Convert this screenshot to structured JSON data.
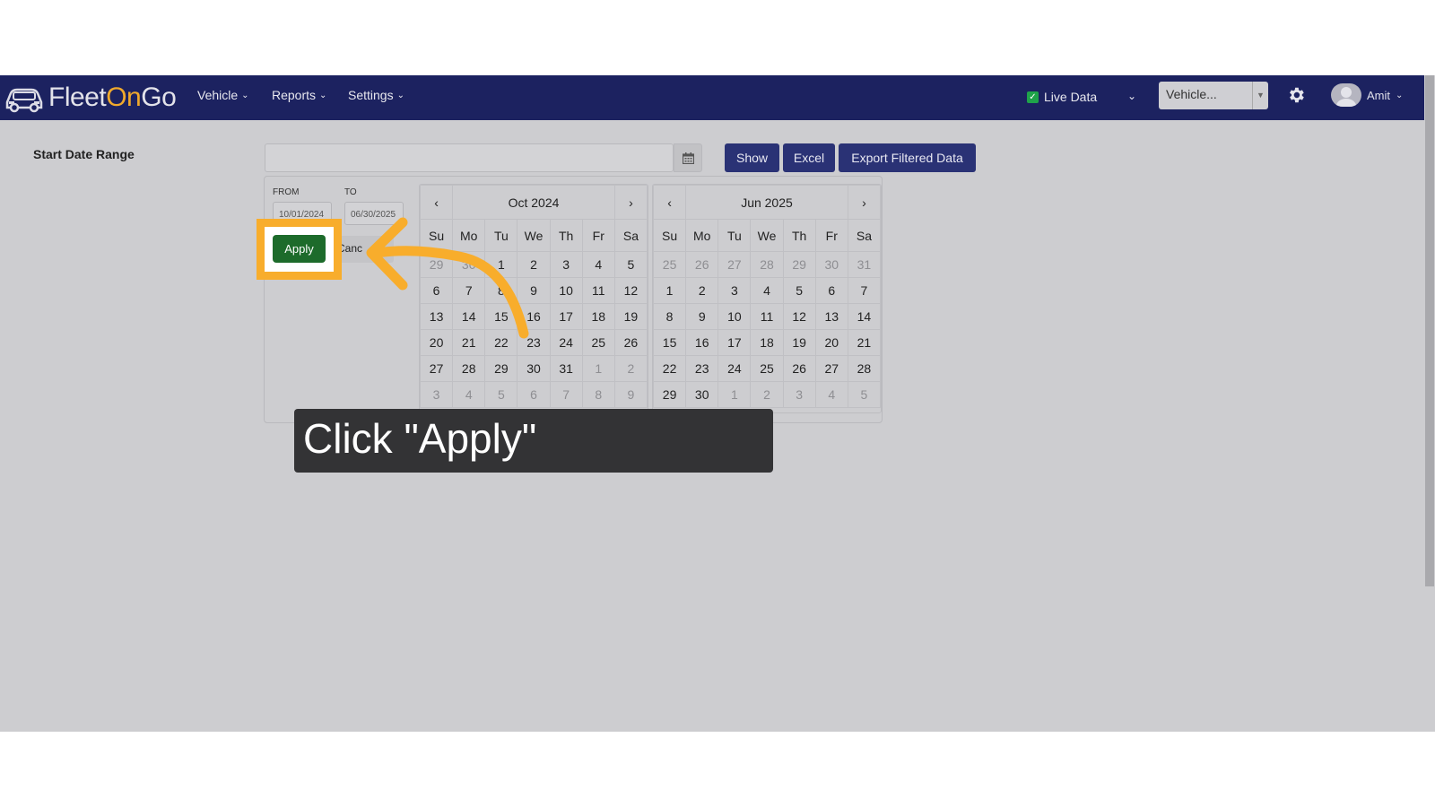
{
  "app": {
    "logo_prefix": "Fleet",
    "logo_accent": "On",
    "logo_suffix": "Go"
  },
  "nav": {
    "menu": [
      {
        "label": "Vehicle"
      },
      {
        "label": "Reports"
      },
      {
        "label": "Settings"
      }
    ],
    "live_data_label": "Live Data",
    "vehicle_select": "Vehicle...",
    "user_name": "Amit"
  },
  "filter": {
    "label": "Start Date Range",
    "show_label": "Show",
    "excel_label": "Excel",
    "export_label": "Export Filtered Data"
  },
  "picker": {
    "from_label": "FROM",
    "to_label": "TO",
    "from_value": "10/01/2024",
    "to_value": "06/30/2025",
    "apply_label": "Apply",
    "cancel_label": "Canc",
    "weekdays": [
      "Su",
      "Mo",
      "Tu",
      "We",
      "Th",
      "Fr",
      "Sa"
    ],
    "left_month": "Oct 2024",
    "right_month": "Jun 2025",
    "left_days": [
      [
        {
          "d": "29",
          "off": true
        },
        {
          "d": "30",
          "off": true
        },
        {
          "d": "1",
          "off": false
        },
        {
          "d": "2",
          "off": false
        },
        {
          "d": "3",
          "off": false
        },
        {
          "d": "4",
          "off": false
        },
        {
          "d": "5",
          "off": false
        }
      ],
      [
        {
          "d": "6",
          "off": false
        },
        {
          "d": "7",
          "off": false
        },
        {
          "d": "8",
          "off": false
        },
        {
          "d": "9",
          "off": false
        },
        {
          "d": "10",
          "off": false
        },
        {
          "d": "11",
          "off": false
        },
        {
          "d": "12",
          "off": false
        }
      ],
      [
        {
          "d": "13",
          "off": false
        },
        {
          "d": "14",
          "off": false
        },
        {
          "d": "15",
          "off": false
        },
        {
          "d": "16",
          "off": false
        },
        {
          "d": "17",
          "off": false
        },
        {
          "d": "18",
          "off": false
        },
        {
          "d": "19",
          "off": false
        }
      ],
      [
        {
          "d": "20",
          "off": false
        },
        {
          "d": "21",
          "off": false
        },
        {
          "d": "22",
          "off": false
        },
        {
          "d": "23",
          "off": false
        },
        {
          "d": "24",
          "off": false
        },
        {
          "d": "25",
          "off": false
        },
        {
          "d": "26",
          "off": false
        }
      ],
      [
        {
          "d": "27",
          "off": false
        },
        {
          "d": "28",
          "off": false
        },
        {
          "d": "29",
          "off": false
        },
        {
          "d": "30",
          "off": false
        },
        {
          "d": "31",
          "off": false
        },
        {
          "d": "1",
          "off": true
        },
        {
          "d": "2",
          "off": true
        }
      ],
      [
        {
          "d": "3",
          "off": true
        },
        {
          "d": "4",
          "off": true
        },
        {
          "d": "5",
          "off": true
        },
        {
          "d": "6",
          "off": true
        },
        {
          "d": "7",
          "off": true
        },
        {
          "d": "8",
          "off": true
        },
        {
          "d": "9",
          "off": true
        }
      ]
    ],
    "right_days": [
      [
        {
          "d": "25",
          "off": true
        },
        {
          "d": "26",
          "off": true
        },
        {
          "d": "27",
          "off": true
        },
        {
          "d": "28",
          "off": true
        },
        {
          "d": "29",
          "off": true
        },
        {
          "d": "30",
          "off": true
        },
        {
          "d": "31",
          "off": true
        }
      ],
      [
        {
          "d": "1",
          "off": false
        },
        {
          "d": "2",
          "off": false
        },
        {
          "d": "3",
          "off": false
        },
        {
          "d": "4",
          "off": false
        },
        {
          "d": "5",
          "off": false
        },
        {
          "d": "6",
          "off": false
        },
        {
          "d": "7",
          "off": false
        }
      ],
      [
        {
          "d": "8",
          "off": false
        },
        {
          "d": "9",
          "off": false
        },
        {
          "d": "10",
          "off": false
        },
        {
          "d": "11",
          "off": false
        },
        {
          "d": "12",
          "off": false
        },
        {
          "d": "13",
          "off": false
        },
        {
          "d": "14",
          "off": false
        }
      ],
      [
        {
          "d": "15",
          "off": false
        },
        {
          "d": "16",
          "off": false
        },
        {
          "d": "17",
          "off": false
        },
        {
          "d": "18",
          "off": false
        },
        {
          "d": "19",
          "off": false
        },
        {
          "d": "20",
          "off": false
        },
        {
          "d": "21",
          "off": false
        }
      ],
      [
        {
          "d": "22",
          "off": false
        },
        {
          "d": "23",
          "off": false
        },
        {
          "d": "24",
          "off": false
        },
        {
          "d": "25",
          "off": false
        },
        {
          "d": "26",
          "off": false
        },
        {
          "d": "27",
          "off": false
        },
        {
          "d": "28",
          "off": false
        }
      ],
      [
        {
          "d": "29",
          "off": false
        },
        {
          "d": "30",
          "off": false
        },
        {
          "d": "1",
          "off": true
        },
        {
          "d": "2",
          "off": true
        },
        {
          "d": "3",
          "off": true
        },
        {
          "d": "4",
          "off": true
        },
        {
          "d": "5",
          "off": true
        }
      ]
    ]
  },
  "tutorial": {
    "callout_text": "Click \"Apply\"",
    "highlight_color": "#f8ad2c"
  },
  "colors": {
    "navbar": "#1c2260",
    "primary_button": "#2a3275",
    "apply_button": "#1d6b2b",
    "logo_accent": "#f0a92c"
  }
}
